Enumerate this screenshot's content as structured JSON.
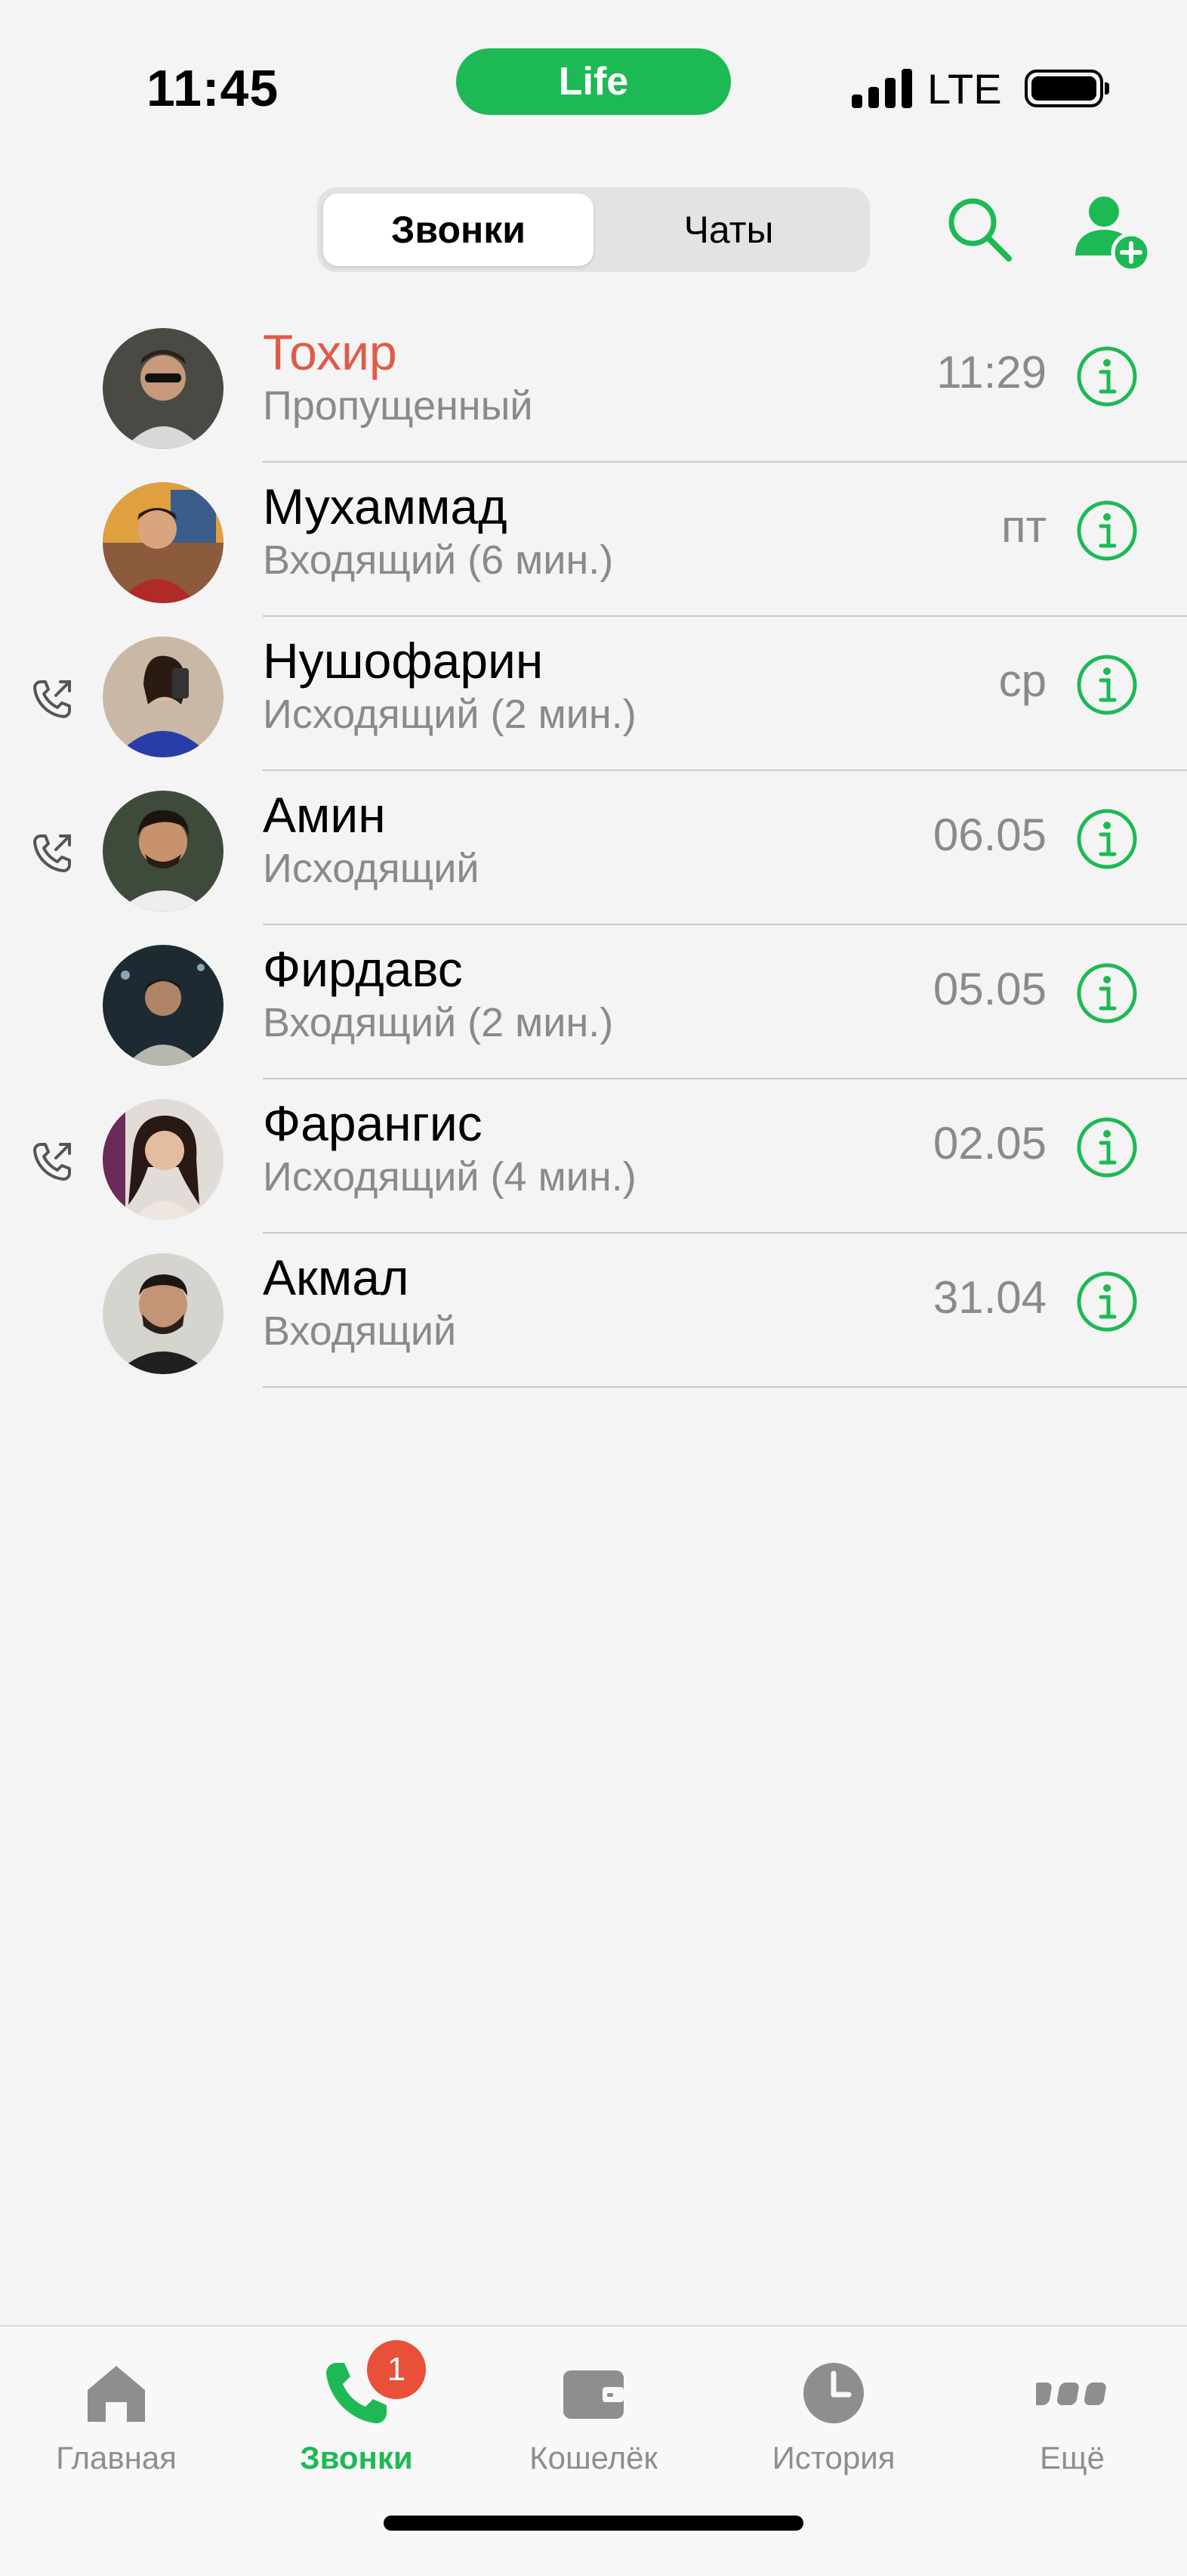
{
  "status_bar": {
    "time": "11:45",
    "carrier_pill": "Life",
    "network": "LTE",
    "icons": [
      "signal-icon",
      "battery-icon"
    ]
  },
  "header": {
    "segments": [
      {
        "label": "Звонки",
        "active": true
      },
      {
        "label": "Чаты",
        "active": false
      }
    ],
    "actions": [
      "search-icon",
      "add-contact-icon"
    ]
  },
  "calls": [
    {
      "name": "Тохир",
      "status": "Пропущенный",
      "time": "11:29",
      "missed": true,
      "outgoing": false
    },
    {
      "name": "Мухаммад",
      "status": "Входящий (6 мин.)",
      "time": "пт",
      "missed": false,
      "outgoing": false
    },
    {
      "name": "Нушофарин",
      "status": "Исходящий (2 мин.)",
      "time": "ср",
      "missed": false,
      "outgoing": true
    },
    {
      "name": "Амин",
      "status": "Исходящий",
      "time": "06.05",
      "missed": false,
      "outgoing": true
    },
    {
      "name": "Фирдавс",
      "status": "Входящий (2 мин.)",
      "time": "05.05",
      "missed": false,
      "outgoing": false
    },
    {
      "name": "Фарангис",
      "status": "Исходящий (4 мин.)",
      "time": "02.05",
      "missed": false,
      "outgoing": true
    },
    {
      "name": "Акмал",
      "status": "Входящий",
      "time": "31.04",
      "missed": false,
      "outgoing": false
    }
  ],
  "tabbar": {
    "items": [
      {
        "label": "Главная",
        "icon": "home-icon",
        "active": false
      },
      {
        "label": "Звонки",
        "icon": "phone-icon",
        "active": true,
        "badge": "1"
      },
      {
        "label": "Кошелёк",
        "icon": "wallet-icon",
        "active": false
      },
      {
        "label": "История",
        "icon": "clock-icon",
        "active": false
      },
      {
        "label": "Ещё",
        "icon": "more-icon",
        "active": false
      }
    ]
  },
  "colors": {
    "accent": "#1db954",
    "missed": "#e05a47",
    "secondary_text": "#8a8a8a",
    "badge": "#e8503a"
  }
}
